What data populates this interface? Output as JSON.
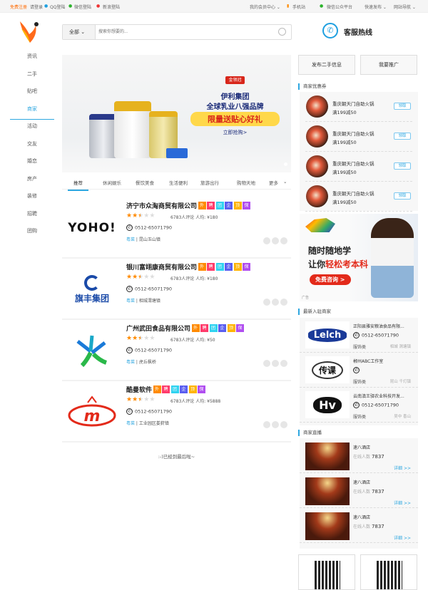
{
  "topbar": {
    "register": "免费注册",
    "login": "请登录",
    "qq": "QQ登陆",
    "wechat": "微信登陆",
    "weibo": "新浪登陆",
    "member": "我的会员中心",
    "mobile": "手机站",
    "wx_platform": "微信公众平台",
    "quick_post": "快速发布",
    "site_nav": "网站导航"
  },
  "search": {
    "category": "全部",
    "placeholder": "搜索你想要的..."
  },
  "hotline": "客服热线",
  "nav": [
    "资讯",
    "二手",
    "贴吧",
    "商家",
    "活动",
    "交友",
    "婚恋",
    "房产",
    "装修",
    "招聘",
    "团购"
  ],
  "nav_active": "商家",
  "banner": {
    "brand": "金领冠",
    "line1": "伊利集团",
    "line2": "全球乳业八强品牌",
    "line3": "限量送贴心好礼",
    "cta": "立即抢购>"
  },
  "tabs": [
    "推荐",
    "休闲娱乐",
    "餐饮美食",
    "生活便利",
    "旅游出行",
    "购物天地",
    "更多"
  ],
  "badges": [
    {
      "t": "外",
      "c": "#ff8a00"
    },
    {
      "t": "聘",
      "c": "#ff3b6b"
    },
    {
      "t": "团",
      "c": "#2fd3f0"
    },
    {
      "t": "企",
      "c": "#5a5ef0"
    },
    {
      "t": "顶",
      "c": "#ffb400"
    },
    {
      "t": "保",
      "c": "#b04ef0"
    }
  ],
  "listings": [
    {
      "logo": "YOHO!",
      "name": "济宁市众淘商贸有限公司",
      "reviews": "6783人评论",
      "avg": "人均: ¥180",
      "phone": "0512-65071790",
      "cuisine": "粤菜",
      "location": "昆山玉山镇",
      "rating": 2.5
    },
    {
      "logo": "旗丰集团",
      "name": "银川富翊康商贸有限公司",
      "reviews": "6783人评论",
      "avg": "人均: ¥180",
      "phone": "0512-65071790",
      "cuisine": "粤菜",
      "location": "相城渭塘镇",
      "rating": 2.5
    },
    {
      "logo": "",
      "name": "广州武田食品有限公司",
      "reviews": "6783人评论",
      "avg": "人均: ¥50",
      "phone": "0512-65071790",
      "cuisine": "粤菜",
      "location": "虎丘枫桥",
      "rating": 2.5
    },
    {
      "logo": "",
      "name": "酷曼软件",
      "reviews": "6783人评论",
      "avg": "人均: ¥5888",
      "phone": "0512-65071790",
      "cuisine": "粤菜",
      "location": "工业园区娄葑镇",
      "rating": 2.5
    }
  ],
  "end_text": ":-)已经到最后啦~",
  "right": {
    "post_btn": "发布二手信息",
    "promote_btn": "我要推广",
    "coupon_title": "商家优惠券",
    "coupons": [
      {
        "name": "重庆朝天门自助火锅",
        "deal": "满199减50",
        "btn": "领取"
      },
      {
        "name": "重庆朝天门自助火锅",
        "deal": "满199减50",
        "btn": "领取"
      },
      {
        "name": "重庆朝天门自助火锅",
        "deal": "满199减50",
        "btn": "领取"
      },
      {
        "name": "重庆朝天门自助火锅",
        "deal": "满199减50",
        "btn": "领取"
      }
    ],
    "ad": {
      "l1": "随时随地学",
      "l2a": "让你",
      "l2b": "轻松考本科",
      "cta": "免费咨询 >",
      "tag": "广告"
    },
    "new_title": "最新入驻商家",
    "new_merchants": [
      {
        "logo": "Lelch",
        "name": "正阳县雅安粮油食品有限...",
        "phone": "0512-65071790",
        "cat": "服饰类",
        "area": "相城 渭塘镇"
      },
      {
        "logo": "传课",
        "name": "郴州ABC工作室",
        "phone": "",
        "cat": "服饰类",
        "area": "昆山 千灯镇"
      },
      {
        "logo": "Hv",
        "name": "云南滇王驿农业科技开发...",
        "phone": "0512-65071790",
        "cat": "服饰类",
        "area": "吴中 香山"
      }
    ],
    "live_title": "商家直播",
    "live": [
      {
        "name": "速八酒店",
        "label": "在线人数",
        "count": "7837",
        "more": "详细 >>"
      },
      {
        "name": "速八酒店",
        "label": "在线人数",
        "count": "7837",
        "more": "详细 >>"
      },
      {
        "name": "速八酒店",
        "label": "在线人数",
        "count": "7837",
        "more": "详细 >>"
      }
    ]
  },
  "colors": {
    "accent": "#2ea7e0",
    "register": "#ff6a00",
    "star": "#ff8a00"
  }
}
